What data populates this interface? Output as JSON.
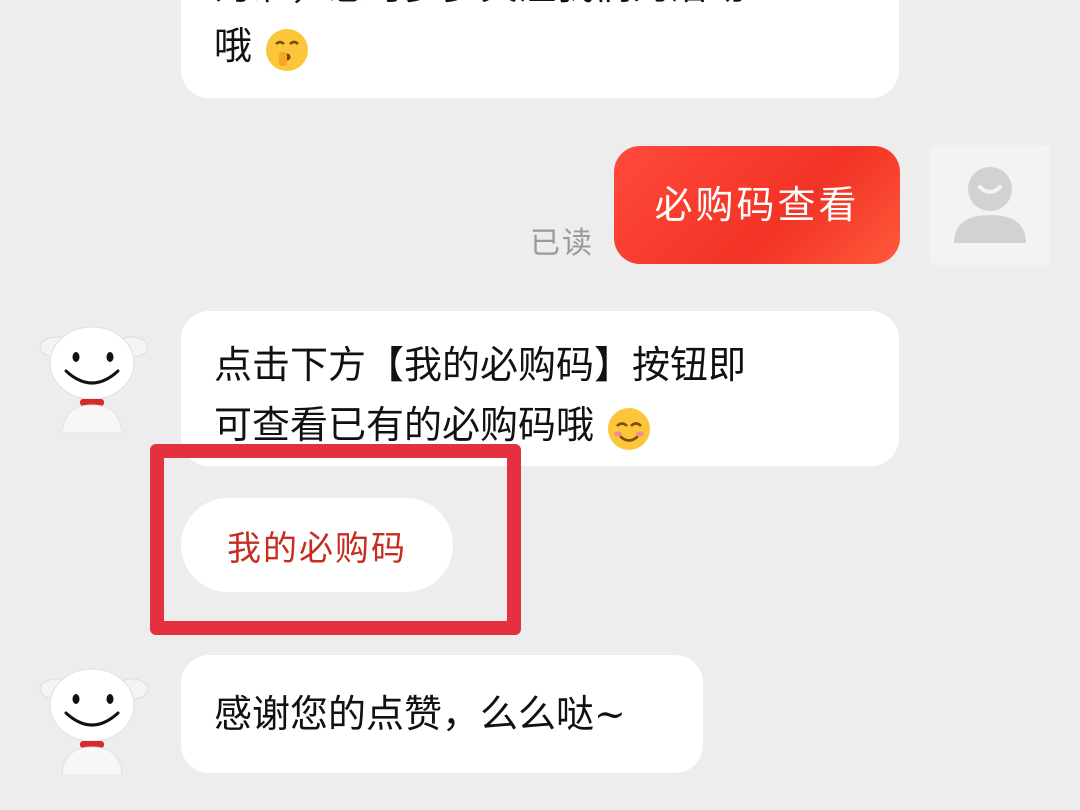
{
  "messages": {
    "prev_line1": "为准，您可多多关注我们的活动",
    "prev_line2": "哦",
    "outgoing": "必购码查看",
    "read_status": "已读",
    "reply_line1": "点击下方【我的必购码】按钮即",
    "reply_line2": "可查看已有的必购码哦",
    "quick_reply_button": "我的必购码",
    "thanks": "感谢您的点赞，么么哒~"
  },
  "icons": {
    "user_avatar": "user-avatar-icon",
    "bot_avatar": "jd-dog-mascot-icon",
    "emoji_shush": "shushing-face-icon",
    "emoji_smile": "smiling-face-icon"
  },
  "colors": {
    "accent_red": "#f23325",
    "highlight_border": "#e53040",
    "button_text": "#c62d20",
    "background": "#ededed"
  }
}
